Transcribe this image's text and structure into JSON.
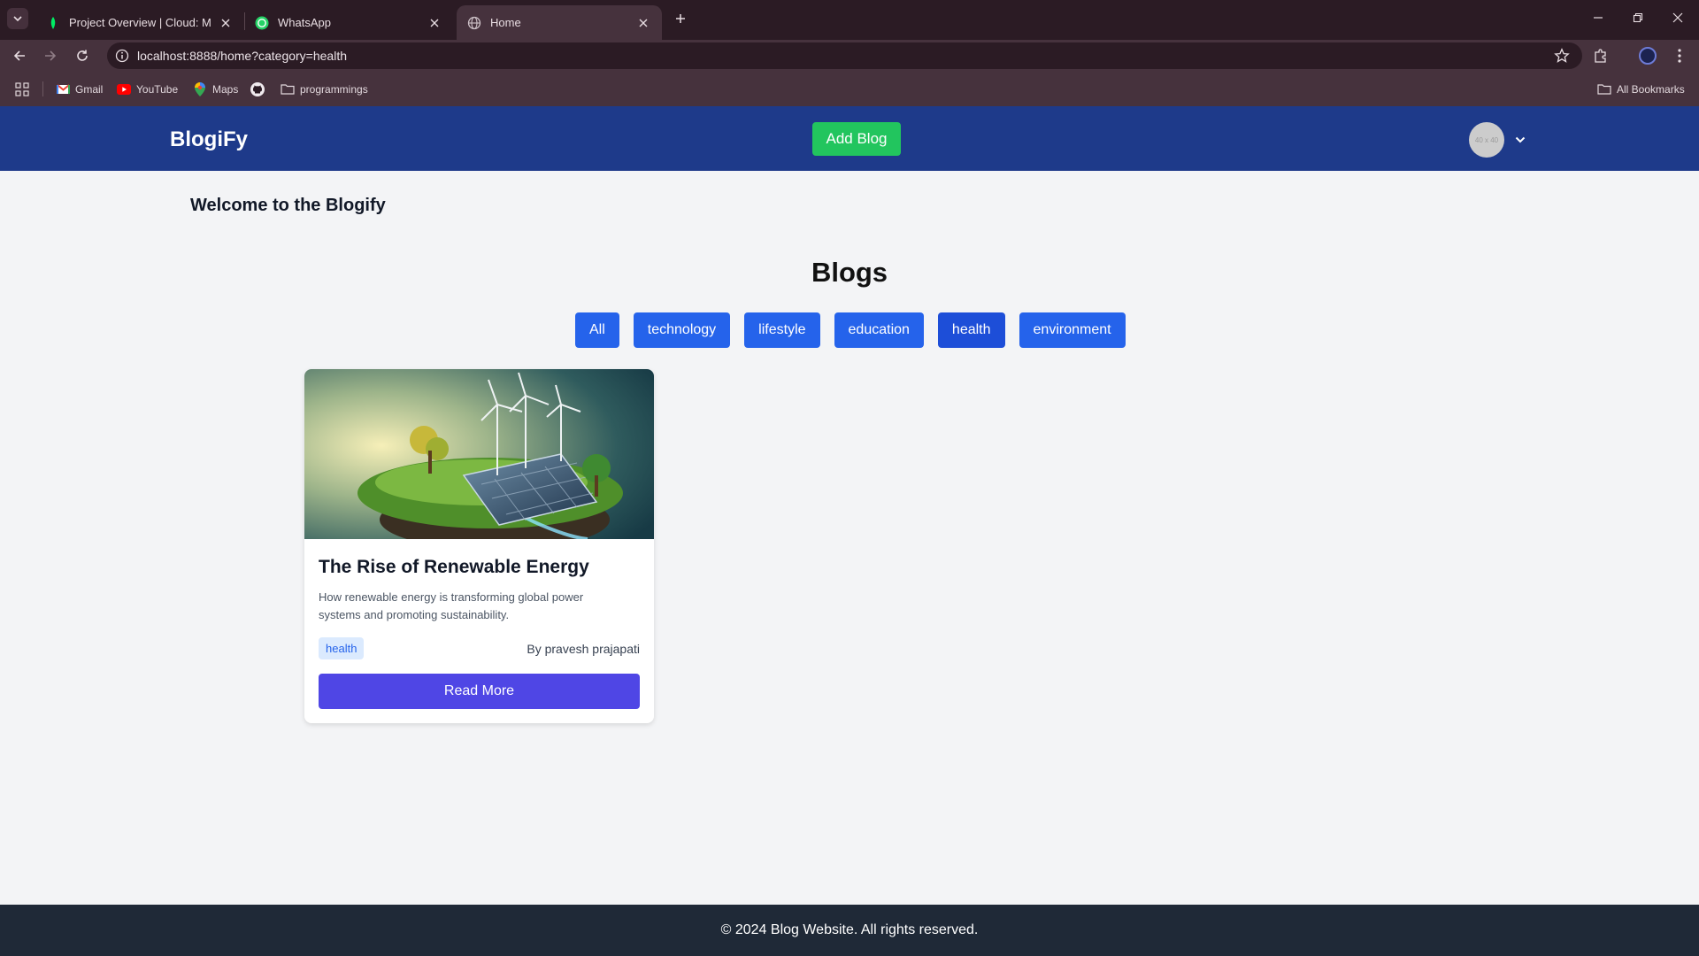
{
  "browser": {
    "tabs": [
      {
        "title": "Project Overview | Cloud: Mong",
        "icon": "mongodb-leaf-icon"
      },
      {
        "title": "WhatsApp",
        "icon": "whatsapp-icon"
      },
      {
        "title": "Home",
        "icon": "globe-icon"
      }
    ],
    "url": "localhost:8888/home?category=health",
    "bookmarks": [
      {
        "label": "Gmail",
        "icon": "gmail-icon"
      },
      {
        "label": "YouTube",
        "icon": "youtube-icon"
      },
      {
        "label": "Maps",
        "icon": "maps-pin-icon"
      },
      {
        "label": "",
        "icon": "github-icon"
      },
      {
        "label": "programmings",
        "icon": "folder-icon"
      }
    ],
    "all_bookmarks": "All Bookmarks"
  },
  "header": {
    "brand": "BlogiFy",
    "add_blog": "Add Blog",
    "avatar_text": "40 x 40"
  },
  "main": {
    "welcome": "Welcome to the Blogify",
    "section_title": "Blogs",
    "filters": [
      "All",
      "technology",
      "lifestyle",
      "education",
      "health",
      "environment"
    ],
    "selected_filter": "health"
  },
  "card": {
    "title": "The Rise of Renewable Energy",
    "description": "How renewable energy is transforming global power systems and promoting sustainability.",
    "tag": "health",
    "author": "By pravesh prajapati",
    "read_more": "Read More"
  },
  "footer": {
    "text": "© 2024 Blog Website. All rights reserved."
  },
  "colors": {
    "header_bg": "#1e3a8a",
    "add_button": "#22c55e",
    "filter_button": "#2563eb",
    "read_more": "#4f46e5",
    "footer_bg": "#1f2937"
  }
}
